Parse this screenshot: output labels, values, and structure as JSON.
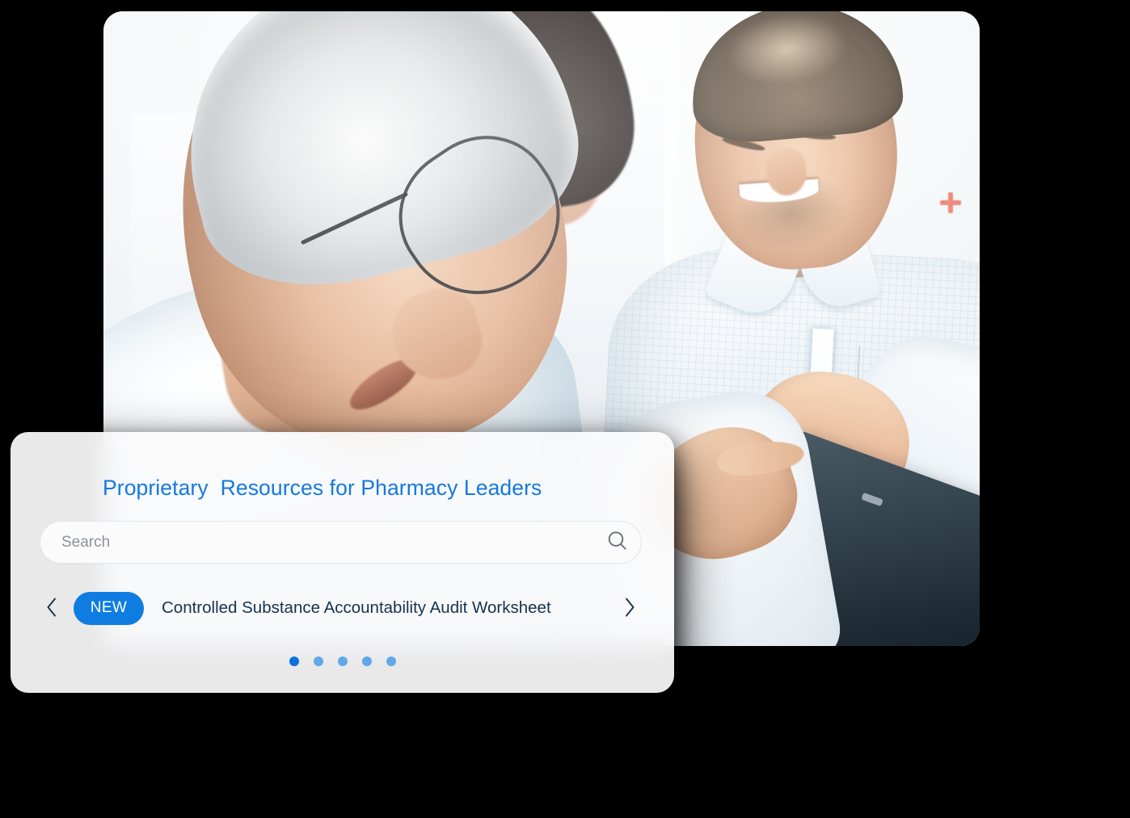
{
  "panel": {
    "title": "Proprietary  Resources for Pharmacy Leaders",
    "title_color": "#1479e0",
    "search": {
      "placeholder": "Search",
      "value": "",
      "icon": "search-icon"
    },
    "carousel": {
      "prev_icon": "chevron-left-icon",
      "next_icon": "chevron-right-icon",
      "badge_label": "NEW",
      "badge_color": "#0f7ce1",
      "item_title": "Controlled Substance Accountability Audit Worksheet",
      "item_title_color": "#16324f",
      "dots": [
        {
          "active": true,
          "color": "#0a72db"
        },
        {
          "active": false,
          "color": "#62a8e8"
        },
        {
          "active": false,
          "color": "#62a8e8"
        },
        {
          "active": false,
          "color": "#62a8e8"
        },
        {
          "active": false,
          "color": "#62a8e8"
        }
      ]
    }
  },
  "photo": {
    "alt": "Two pharmacists smiling while reviewing a tablet together",
    "accent_color": "#e8604c"
  },
  "background_color": "#000000"
}
